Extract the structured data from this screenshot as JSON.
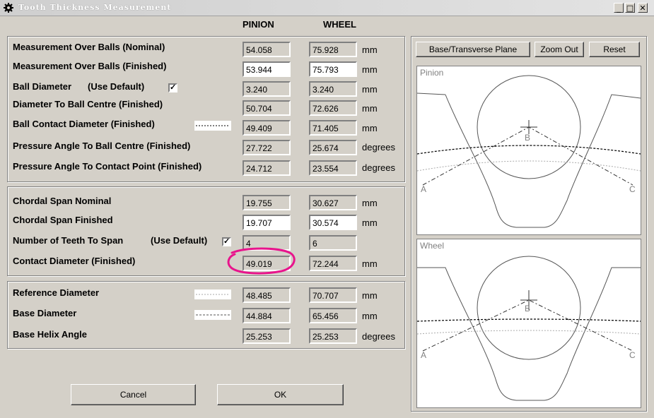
{
  "window": {
    "title": "Tooth Thickness Measurement"
  },
  "columns": {
    "pinion": "PINION",
    "wheel": "WHEEL"
  },
  "rows": [
    {
      "label": "Measurement Over Balls (Nominal)",
      "pinion": "54.058",
      "wheel": "75.928",
      "unit": "mm"
    },
    {
      "label": "Measurement Over Balls (Finished)",
      "pinion": "53.944",
      "wheel": "75.793",
      "unit": "mm"
    },
    {
      "label": "Ball Diameter",
      "option": "(Use Default)",
      "pinion": "3.240",
      "wheel": "3.240",
      "unit": "mm"
    },
    {
      "label": "Diameter To Ball Centre (Finished)",
      "pinion": "50.704",
      "wheel": "72.626",
      "unit": "mm"
    },
    {
      "label": "Ball Contact Diameter (Finished)",
      "pinion": "49.409",
      "wheel": "71.405",
      "unit": "mm"
    },
    {
      "label": "Pressure Angle To Ball Centre (Finished)",
      "pinion": "27.722",
      "wheel": "25.674",
      "unit": "degrees"
    },
    {
      "label": "Pressure Angle To Contact Point (Finished)",
      "pinion": "24.712",
      "wheel": "23.554",
      "unit": "degrees"
    },
    {
      "label": "Chordal Span Nominal",
      "pinion": "19.755",
      "wheel": "30.627",
      "unit": "mm"
    },
    {
      "label": "Chordal Span Finished",
      "pinion": "19.707",
      "wheel": "30.574",
      "unit": "mm"
    },
    {
      "label": "Number of Teeth To Span",
      "option": "(Use Default)",
      "pinion": "4",
      "wheel": "6",
      "unit": ""
    },
    {
      "label": "Contact Diameter (Finished)",
      "pinion": "49.019",
      "wheel": "72.244",
      "unit": "mm"
    },
    {
      "label": "Reference Diameter",
      "pinion": "48.485",
      "wheel": "70.707",
      "unit": "mm"
    },
    {
      "label": "Base Diameter",
      "pinion": "44.884",
      "wheel": "65.456",
      "unit": "mm"
    },
    {
      "label": "Base Helix Angle",
      "pinion": "25.253",
      "wheel": "25.253",
      "unit": "degrees"
    }
  ],
  "checkmark": "✓",
  "buttons": {
    "cancel": "Cancel",
    "ok": "OK",
    "plane": "Base/Transverse Plane",
    "zoom_out": "Zoom Out",
    "reset": "Reset"
  },
  "views": {
    "pinion": {
      "label": "Pinion",
      "points": [
        "A",
        "B",
        "C"
      ]
    },
    "wheel": {
      "label": "Wheel",
      "points": [
        "A",
        "B",
        "C"
      ]
    }
  },
  "annotation": {
    "color": "#e8148c"
  }
}
